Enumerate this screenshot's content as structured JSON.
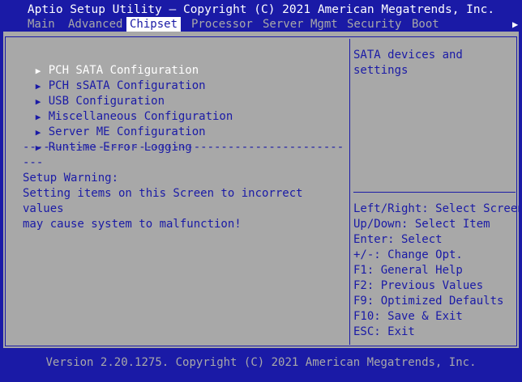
{
  "window": {
    "title": "Aptio Setup Utility – Copyright (C) 2021 American Megatrends, Inc."
  },
  "tabs": [
    {
      "label": "Main",
      "active": false
    },
    {
      "label": "Advanced",
      "active": false
    },
    {
      "label": "Chipset",
      "active": true
    },
    {
      "label": "Processor",
      "active": false
    },
    {
      "label": "Server Mgmt",
      "active": false
    },
    {
      "label": "Security",
      "active": false
    },
    {
      "label": "Boot",
      "active": false
    }
  ],
  "tab_overflow_icon": "right-arrow",
  "menu": {
    "items": [
      {
        "label": "PCH SATA Configuration",
        "selected": true
      },
      {
        "label": "PCH sSATA Configuration",
        "selected": false
      },
      {
        "label": "USB Configuration",
        "selected": false
      },
      {
        "label": "Miscellaneous Configuration",
        "selected": false
      },
      {
        "label": "Server ME Configuration",
        "selected": false
      },
      {
        "label": "Runtime Error Logging",
        "selected": false
      }
    ],
    "separator_line1": "-----------------------------------------------",
    "separator_line2": "---",
    "warning_title": "Setup Warning:",
    "warning_line1": "Setting items on this Screen to incorrect",
    "warning_line2": "values",
    "warning_line3": "may cause system to malfunction!"
  },
  "help": {
    "line1": "SATA devices and",
    "line2": "settings"
  },
  "keys": [
    "Left/Right: Select Screen",
    "Up/Down: Select Item",
    "Enter: Select",
    "+/-: Change Opt.",
    "F1: General Help",
    "F2: Previous Values",
    "F9: Optimized Defaults",
    "F10: Save & Exit",
    "ESC: Exit"
  ],
  "footer": "Version 2.20.1275. Copyright (C) 2021 American Megatrends, Inc.",
  "colors": {
    "bios_blue": "#1a1aa6",
    "panel_gray": "#a8a8a8",
    "highlight": "#ffffff"
  }
}
